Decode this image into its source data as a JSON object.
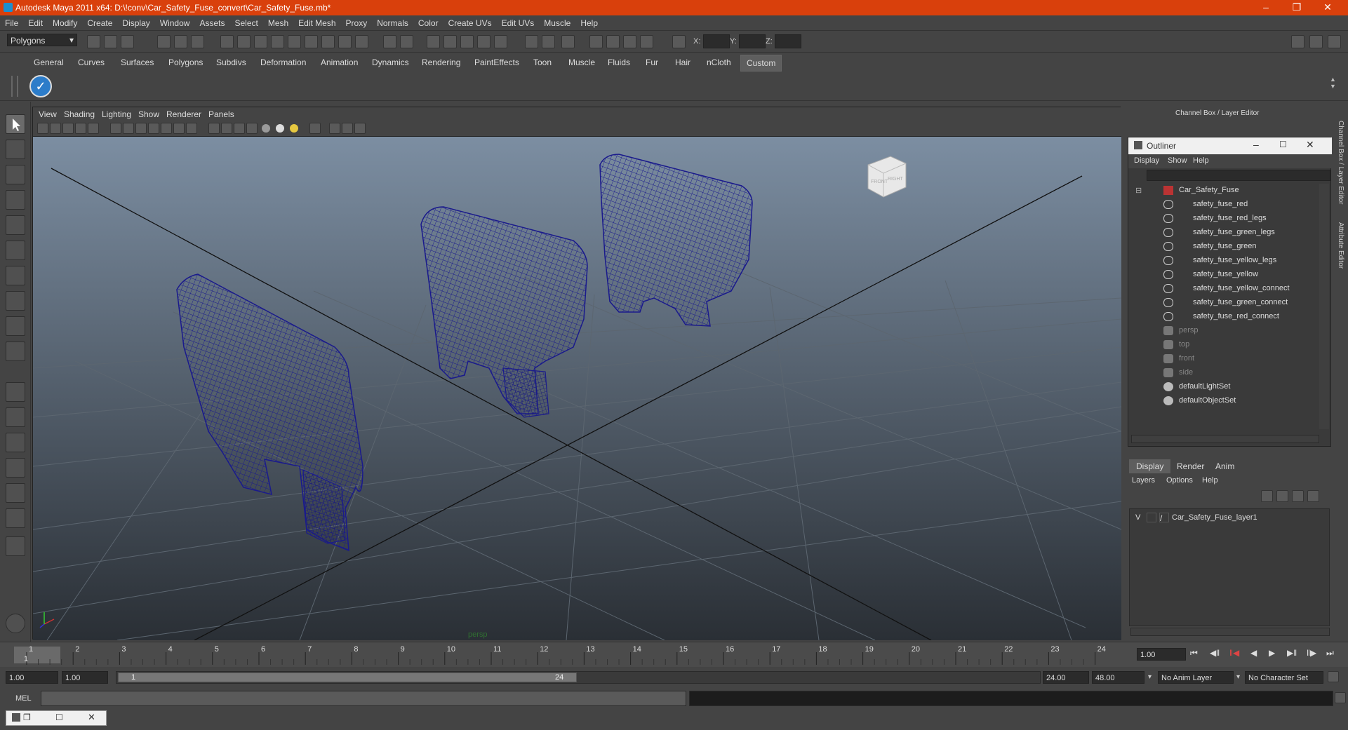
{
  "window": {
    "title": "Autodesk Maya 2011 x64: D:\\!conv\\Car_Safety_Fuse_convert\\Car_Safety_Fuse.mb*"
  },
  "menubar": [
    "File",
    "Edit",
    "Modify",
    "Create",
    "Display",
    "Window",
    "Assets",
    "Select",
    "Mesh",
    "Edit Mesh",
    "Proxy",
    "Normals",
    "Color",
    "Create UVs",
    "Edit UVs",
    "Muscle",
    "Help"
  ],
  "statusline": {
    "mode_select": "Polygons",
    "x_label": "X:",
    "y_label": "Y:",
    "z_label": "Z:"
  },
  "shelf_tabs": [
    "General",
    "Curves",
    "Surfaces",
    "Polygons",
    "Subdivs",
    "Deformation",
    "Animation",
    "Dynamics",
    "Rendering",
    "PaintEffects",
    "Toon",
    "Muscle",
    "Fluids",
    "Fur",
    "Hair",
    "nCloth",
    "Custom"
  ],
  "shelf_active_tab": "Custom",
  "viewport": {
    "menu": [
      "View",
      "Shading",
      "Lighting",
      "Show",
      "Renderer",
      "Panels"
    ],
    "camera_label": "persp",
    "viewcube_front": "FRONT",
    "viewcube_right": "RIGHT"
  },
  "channel_box": {
    "title": "Channel Box / Layer Editor",
    "side_tab_1": "Channel Box / Layer Editor",
    "side_tab_2": "Attribute Editor"
  },
  "outliner": {
    "title": "Outliner",
    "menu": [
      "Display",
      "Show",
      "Help"
    ],
    "items": [
      {
        "label": "Car_Safety_Fuse",
        "type": "group",
        "dim": false
      },
      {
        "label": "safety_fuse_red",
        "type": "mesh",
        "dim": false
      },
      {
        "label": "safety_fuse_red_legs",
        "type": "mesh",
        "dim": false
      },
      {
        "label": "safety_fuse_green_legs",
        "type": "mesh",
        "dim": false
      },
      {
        "label": "safety_fuse_green",
        "type": "mesh",
        "dim": false
      },
      {
        "label": "safety_fuse_yellow_legs",
        "type": "mesh",
        "dim": false
      },
      {
        "label": "safety_fuse_yellow",
        "type": "mesh",
        "dim": false
      },
      {
        "label": "safety_fuse_yellow_connect",
        "type": "mesh",
        "dim": false
      },
      {
        "label": "safety_fuse_green_connect",
        "type": "mesh",
        "dim": false
      },
      {
        "label": "safety_fuse_red_connect",
        "type": "mesh",
        "dim": false
      },
      {
        "label": "persp",
        "type": "camera",
        "dim": true
      },
      {
        "label": "top",
        "type": "camera",
        "dim": true
      },
      {
        "label": "front",
        "type": "camera",
        "dim": true
      },
      {
        "label": "side",
        "type": "camera",
        "dim": true
      },
      {
        "label": "defaultLightSet",
        "type": "set",
        "dim": false
      },
      {
        "label": "defaultObjectSet",
        "type": "set",
        "dim": false
      }
    ]
  },
  "layers": {
    "tabs": [
      "Display",
      "Render",
      "Anim"
    ],
    "active_tab": "Display",
    "menu": [
      "Layers",
      "Options",
      "Help"
    ],
    "layer_visible": "V",
    "layer_name": "Car_Safety_Fuse_layer1"
  },
  "timeline": {
    "ticks": [
      "1",
      "2",
      "3",
      "4",
      "5",
      "6",
      "7",
      "8",
      "9",
      "10",
      "11",
      "12",
      "13",
      "14",
      "15",
      "16",
      "17",
      "18",
      "19",
      "20",
      "21",
      "22",
      "23",
      "24"
    ],
    "current_frame_marker": "1",
    "current_frame": "1.00"
  },
  "range": {
    "start": "1.00",
    "playback_start": "1.00",
    "range_start_label": "1",
    "range_end_label": "24",
    "playback_end": "24.00",
    "end": "48.00",
    "anim_layer": "No Anim Layer",
    "character_set": "No Character Set"
  },
  "cmdline": {
    "label": "MEL"
  },
  "colors": {
    "title_bar": "#d9400c",
    "wire": "#1a1a8c",
    "viewport_top": "#7c8ea2",
    "viewport_bottom": "#2a2f35"
  }
}
